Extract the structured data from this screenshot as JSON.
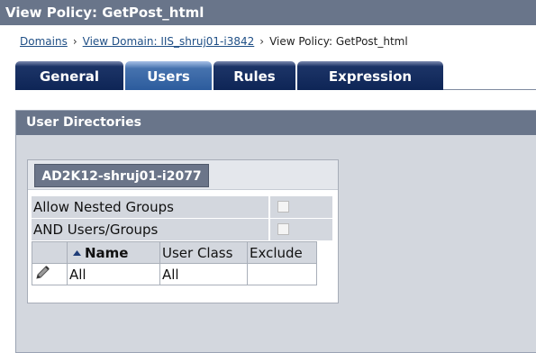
{
  "window": {
    "title": "View Policy: GetPost_html"
  },
  "breadcrumb": {
    "items": [
      "Domains",
      "View Domain: IIS_shruj01-i3842"
    ],
    "current": "View Policy: GetPost_html",
    "separator": "›"
  },
  "tabs": [
    {
      "label": "General",
      "active": false
    },
    {
      "label": "Users",
      "active": true
    },
    {
      "label": "Rules",
      "active": false
    },
    {
      "label": "Expression",
      "active": false
    }
  ],
  "panel": {
    "title": "User Directories",
    "directory_tab": "AD2K12-shruj01-i2077",
    "options": [
      {
        "label": "Allow Nested Groups",
        "checked": false
      },
      {
        "label": "AND Users/Groups",
        "checked": false
      }
    ],
    "table": {
      "columns": [
        "Name",
        "User Class",
        "Exclude"
      ],
      "sorted_column": "Name",
      "rows": [
        {
          "name": "All",
          "user_class": "All",
          "exclude": ""
        }
      ]
    }
  },
  "colors": {
    "title_bar": "#69758a",
    "tab_inactive": "#0e2556",
    "tab_active": "#2c5c9d",
    "panel_background": "#d3d7de",
    "link": "#1f4f86"
  },
  "icons": {
    "edit": "pencil-icon",
    "sort": "sort-ascending-icon"
  }
}
